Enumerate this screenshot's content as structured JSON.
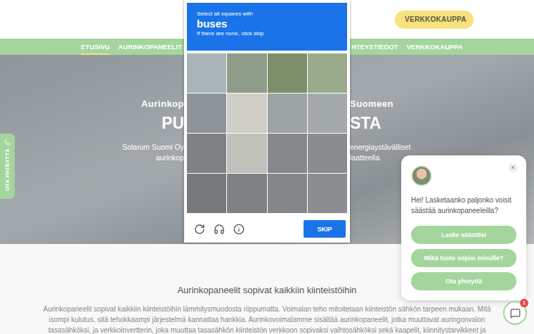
{
  "header": {
    "shop_button": "VERKKOKAUPPA"
  },
  "nav": {
    "left": [
      {
        "label": "ETUSIVU",
        "selected": true,
        "dropdown": false
      },
      {
        "label": "AURINKOPANEELIT",
        "selected": false,
        "dropdown": true
      }
    ],
    "right": [
      {
        "label": "HTEYSTIEDOT",
        "selected": false,
        "dropdown": false
      },
      {
        "label": "VERKKOKAUPPA",
        "selected": false,
        "dropdown": false
      }
    ]
  },
  "hero": {
    "rows": [
      {
        "kind": "eyebrow",
        "left": "Aurinkop",
        "right": "Suomeen"
      },
      {
        "kind": "title",
        "left": "PU",
        "right": "STA"
      },
      {
        "kind": "body",
        "left": "Solarum Suomi Oy",
        "right": "energiaystävälliset"
      },
      {
        "kind": "body",
        "left": "aurinkop",
        "right": "laatteella."
      }
    ]
  },
  "side_tab": {
    "label": "OTA YHTEYTTÄ"
  },
  "captcha": {
    "prompt": "Select all squares with",
    "target": "buses",
    "hint": "If there are none, click skip",
    "skip": "SKIP"
  },
  "intro": {
    "heading": "Aurinkopaneelit sopivat kaikkiin kiinteistöihin",
    "text": "Aurinkopaneelit sopivat kaikkiin kiinteistöihin lämmitysmuodosta riippumatta. Voimalan teho mitoitetaan kiinteistön sähkön tarpeen mukaan. Mitä isompi kulutus, sitä tehokkaampi järjestelmä kannattaa hankkia. Aurinkovoimalamme sisältää aurinkopaneelit, jotka muuttavat auringonvalon tasasähköksi, ja verkkoinvertterin, joka muuttaa tasasähkön kiinteistön verkkoon sopivaksi vaihtosähköksi sekä kaapelit, kiinnitystarvikkeet ja"
  },
  "chat": {
    "close": "×",
    "greeting": "Hei! Lasketaanko paljonko voisit säästää aurinkopaneeleilla?",
    "options": [
      "Laske säästösi",
      "Mikä tuote sopisi minulle?",
      "Ota yhteyttä"
    ],
    "launcher_badge": "1"
  }
}
